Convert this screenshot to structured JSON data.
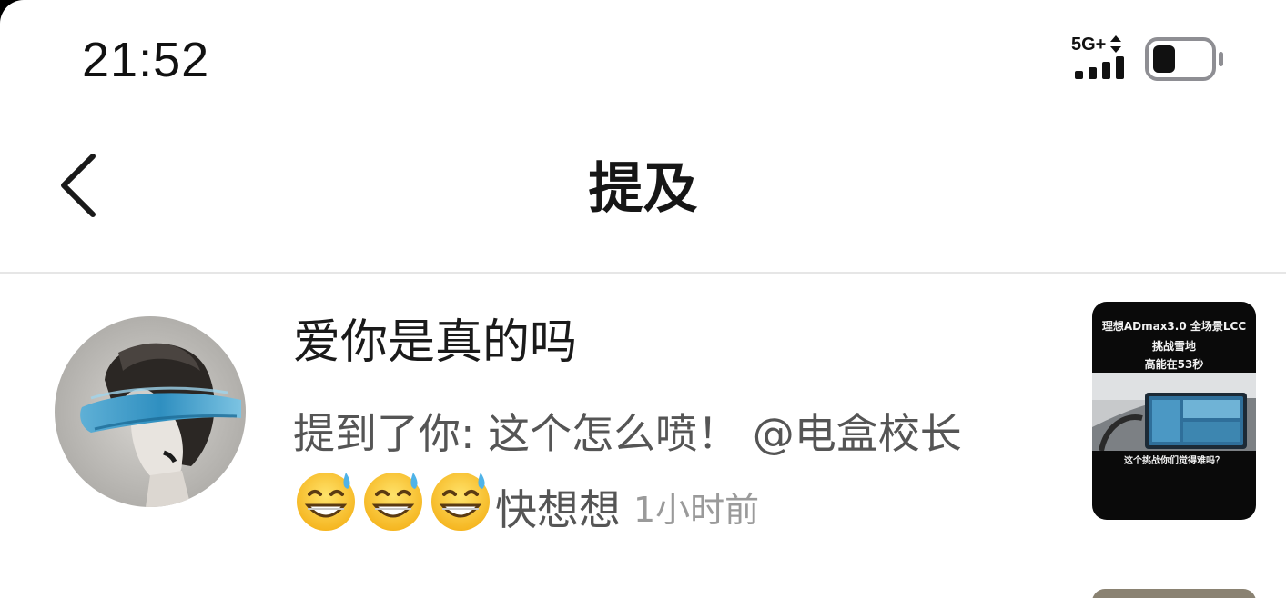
{
  "status_bar": {
    "time": "21:52",
    "network": "5G+",
    "signal_bars": 4,
    "battery_level": 0.4
  },
  "nav": {
    "title": "提及",
    "back_icon": "chevron-left-icon"
  },
  "notifications": [
    {
      "username": "爱你是真的吗",
      "message_line1": "提到了你: 这个怎么喷！ @电盒校长",
      "emoji_icon": "grinning-sweat-emoji",
      "emoji_count": 3,
      "message_tail": "快想想",
      "time_ago": "1小时前",
      "thumbnail": {
        "line1": "理想ADmax3.0 全场景LCC",
        "line2": "挑战雪地",
        "line3": "高能在53秒",
        "caption": "这个挑战你们觉得难吗？"
      }
    }
  ],
  "colors": {
    "background": "#ffffff",
    "title": "#161616",
    "message": "#555555",
    "time": "#9a9a9a",
    "divider": "#e6e6e6"
  }
}
